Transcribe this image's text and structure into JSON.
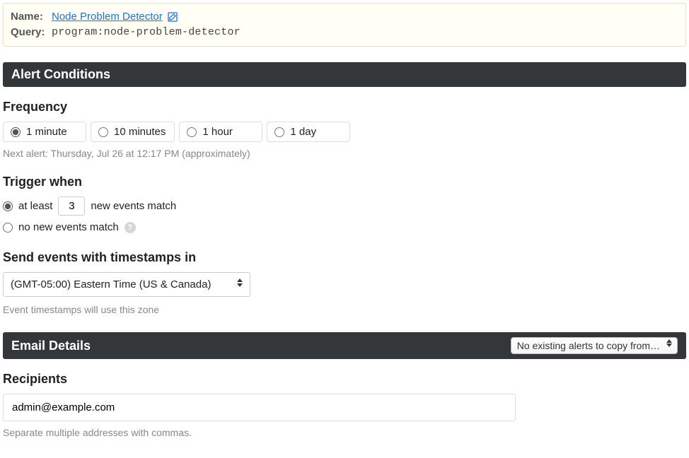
{
  "infobox": {
    "name_label": "Name:",
    "name_value": "Node Problem Detector",
    "query_label": "Query:",
    "query_value": "program:node-problem-detector"
  },
  "alert_conditions": {
    "title": "Alert Conditions",
    "frequency": {
      "label": "Frequency",
      "options": [
        "1 minute",
        "10 minutes",
        "1 hour",
        "1 day"
      ],
      "selected": "1 minute",
      "next_alert": "Next alert: Thursday, Jul 26 at 12:17 PM (approximately)"
    },
    "trigger": {
      "label": "Trigger when",
      "at_least_prefix": "at least",
      "at_least_value": "3",
      "at_least_suffix": "new events match",
      "no_new_label": "no new events match",
      "selected": "at_least"
    },
    "timezone": {
      "label": "Send events with timestamps in",
      "value": "(GMT-05:00) Eastern Time (US & Canada)",
      "note": "Event timestamps will use this zone"
    }
  },
  "email_details": {
    "title": "Email Details",
    "copy_placeholder": "No existing alerts to copy from…",
    "recipients": {
      "label": "Recipients",
      "value": "admin@example.com",
      "note": "Separate multiple addresses with commas."
    }
  }
}
